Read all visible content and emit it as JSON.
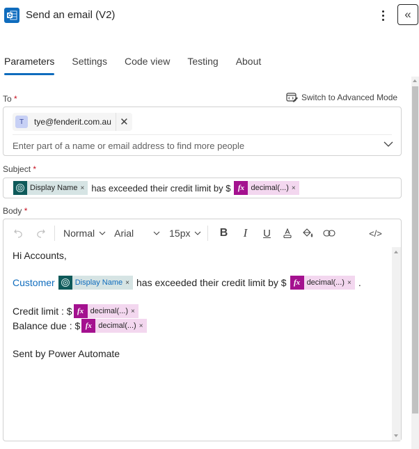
{
  "header": {
    "title": "Send an email (V2)",
    "app_icon": "outlook-icon",
    "more_icon": "more-vertical-icon",
    "collapse_icon": "double-chevron-left-icon",
    "collapse_glyph": "«"
  },
  "tabs": [
    {
      "label": "Parameters",
      "active": true
    },
    {
      "label": "Settings",
      "active": false
    },
    {
      "label": "Code view",
      "active": false
    },
    {
      "label": "Testing",
      "active": false
    },
    {
      "label": "About",
      "active": false
    }
  ],
  "advanced_mode": {
    "label": "Switch to Advanced Mode",
    "icon": "code-edit-icon"
  },
  "to": {
    "label": "To",
    "required_mark": "*",
    "recipients": [
      {
        "initial": "T",
        "email": "tye@fenderit.com.au",
        "remove_glyph": "✕"
      }
    ],
    "placeholder": "Enter part of a name or email address to find more people"
  },
  "subject": {
    "label": "Subject",
    "required_mark": "*",
    "token1": {
      "label": "Display Name",
      "remove": "×"
    },
    "text1": "has exceeded their credit limit by $",
    "token2": {
      "icon_text": "fx",
      "label": "decimal(...)",
      "remove": "×"
    }
  },
  "body": {
    "label": "Body",
    "required_mark": "*",
    "toolbar": {
      "undo": "undo-icon",
      "redo": "redo-icon",
      "block_format": "Normal",
      "font": "Arial",
      "font_size": "15px",
      "bold": "B",
      "italic": "I",
      "underline": "U",
      "html_toggle": "</>"
    },
    "lines": {
      "greeting": "Hi Accounts,",
      "line2_prefix": "Customer",
      "line2_token": {
        "label": "Display Name",
        "remove": "×"
      },
      "line2_text": "has exceeded their credit limit by $",
      "line2_fx": {
        "icon_text": "fx",
        "label": "decimal(...)",
        "remove": "×"
      },
      "line2_suffix": ".",
      "credit_label": "Credit limit : $",
      "credit_fx": {
        "icon_text": "fx",
        "label": "decimal(...)",
        "remove": "×"
      },
      "balance_label": "Balance due : $",
      "balance_fx": {
        "icon_text": "fx",
        "label": "decimal(...)",
        "remove": "×"
      },
      "signature": "Sent by Power Automate"
    }
  },
  "colors": {
    "accent": "#0f6cbd",
    "dynamic_token_bg": "#d6e4e4",
    "dynamic_token_icon": "#0e5a5a",
    "fx_token_bg": "#f3d7ef",
    "fx_token_icon": "#a4118f",
    "required": "#c50f1f"
  }
}
